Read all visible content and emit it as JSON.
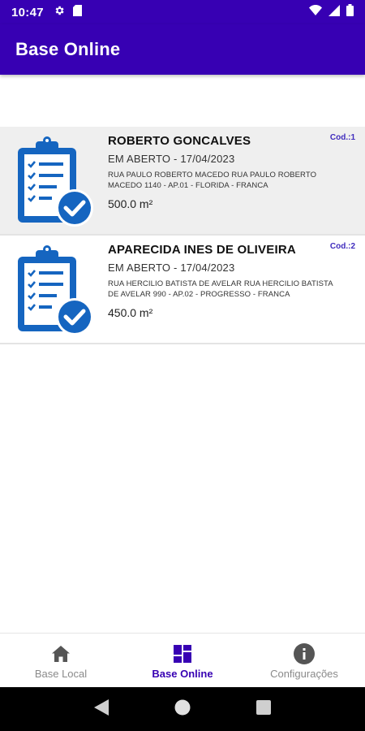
{
  "status_bar": {
    "time": "10:47",
    "left_icons": [
      "gear-icon",
      "sim-card-icon"
    ],
    "right_icons": [
      "wifi-icon",
      "signal-icon",
      "battery-icon"
    ]
  },
  "app_bar": {
    "title": "Base Online",
    "color": "#3700b3"
  },
  "records": [
    {
      "name": "ROBERTO GONCALVES",
      "status": "EM ABERTO - 17/04/2023",
      "address": "RUA PAULO ROBERTO MACEDO RUA PAULO ROBERTO MACEDO 1140 - AP.01 - FLORIDA - FRANCA",
      "area": "500.0 m²",
      "code": "Cod.:1",
      "icon": "clipboard-check-icon"
    },
    {
      "name": "APARECIDA INES DE OLIVEIRA",
      "status": "EM ABERTO - 17/04/2023",
      "address": "RUA HERCILIO BATISTA DE AVELAR RUA HERCILIO BATISTA DE AVELAR 990 - AP.02 - PROGRESSO - FRANCA",
      "area": "450.0 m²",
      "code": "Cod.:2",
      "icon": "clipboard-check-icon"
    }
  ],
  "bottom_nav": {
    "items": [
      {
        "label": "Base Local",
        "icon": "home-icon"
      },
      {
        "label": "Base Online",
        "icon": "dashboard-icon",
        "active": true
      },
      {
        "label": "Configurações",
        "icon": "info-icon"
      }
    ]
  },
  "system_nav": {
    "icons": [
      "back-icon",
      "home-circle-icon",
      "recents-icon"
    ]
  },
  "colors": {
    "accent": "#3700b3",
    "icon_blue": "#1565c0",
    "code_text": "#3f2bbd"
  }
}
